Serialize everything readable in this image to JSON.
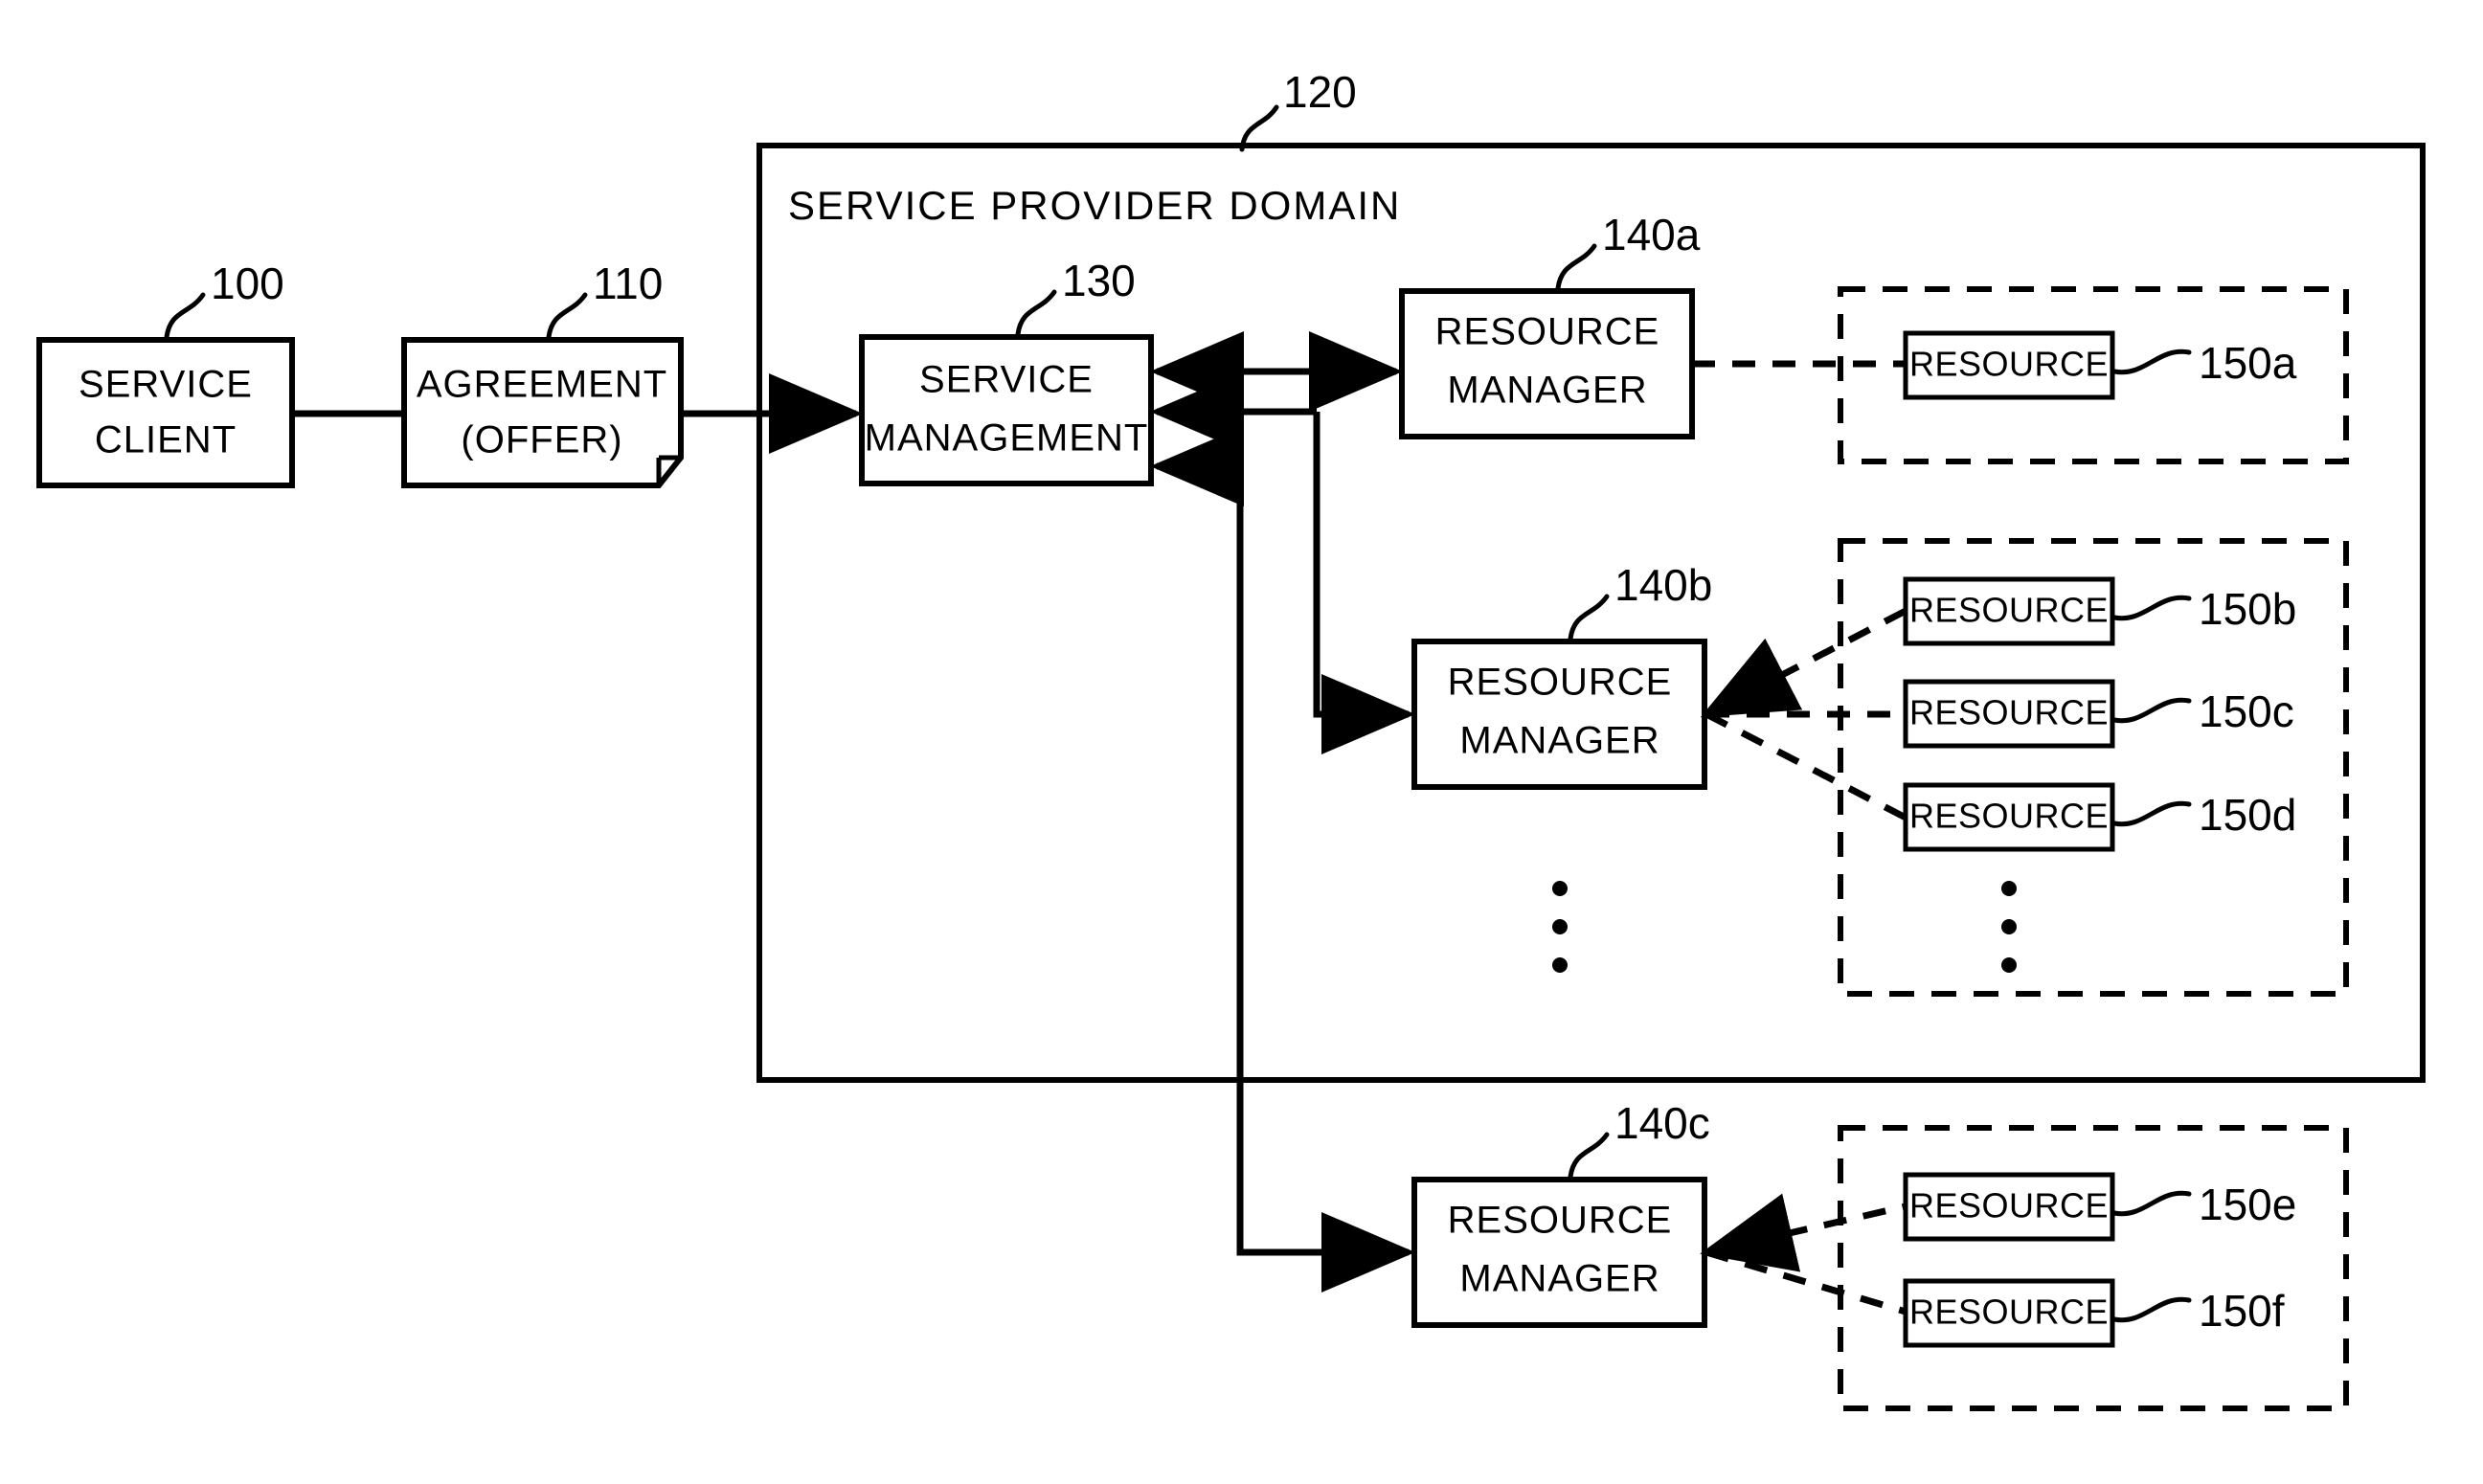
{
  "figure": {
    "title": "Service provider domain architecture diagram",
    "background": "#ffffff",
    "stroke_color": "#000000"
  },
  "nodes": {
    "service_client": {
      "label_line1": "SERVICE",
      "label_line2": "CLIENT",
      "ref": "100"
    },
    "agreement": {
      "label_line1": "AGREEMENT",
      "label_line2": "(OFFER)",
      "ref": "110"
    },
    "domain": {
      "title": "SERVICE PROVIDER DOMAIN",
      "ref": "120"
    },
    "service_management": {
      "label_line1": "SERVICE",
      "label_line2": "MANAGEMENT",
      "ref": "130"
    },
    "resource_manager_a": {
      "label_line1": "RESOURCE",
      "label_line2": "MANAGER",
      "ref": "140a"
    },
    "resource_manager_b": {
      "label_line1": "RESOURCE",
      "label_line2": "MANAGER",
      "ref": "140b"
    },
    "resource_manager_c": {
      "label_line1": "RESOURCE",
      "label_line2": "MANAGER",
      "ref": "140c"
    }
  },
  "resource_groups": [
    {
      "id": "group-a",
      "resources": [
        {
          "label": "RESOURCE",
          "ref": "150a"
        }
      ],
      "has_ellipsis": false
    },
    {
      "id": "group-b",
      "resources": [
        {
          "label": "RESOURCE",
          "ref": "150b"
        },
        {
          "label": "RESOURCE",
          "ref": "150c"
        },
        {
          "label": "RESOURCE",
          "ref": "150d"
        }
      ],
      "has_ellipsis": true
    },
    {
      "id": "group-c",
      "resources": [
        {
          "label": "RESOURCE",
          "ref": "150e"
        },
        {
          "label": "RESOURCE",
          "ref": "150f"
        }
      ],
      "has_ellipsis": false
    }
  ],
  "ellipsis": {
    "manager_column": {
      "visible": true
    },
    "resource_column": {
      "visible": true
    }
  }
}
